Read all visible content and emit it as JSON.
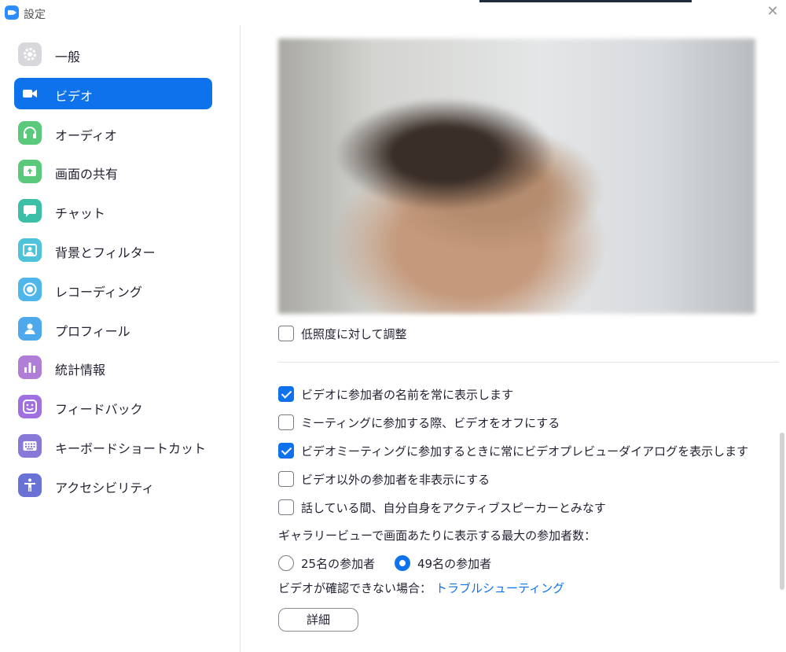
{
  "window": {
    "title": "設定",
    "close_glyph": "✕"
  },
  "sidebar": {
    "items": [
      {
        "label": "一般",
        "icon": "gear-icon",
        "color": "#D8D8DC"
      },
      {
        "label": "ビデオ",
        "icon": "video-icon",
        "color": "#0E72ED",
        "active": true
      },
      {
        "label": "オーディオ",
        "icon": "headphones-icon",
        "color": "#5BC97C"
      },
      {
        "label": "画面の共有",
        "icon": "share-screen-icon",
        "color": "#5BC97C"
      },
      {
        "label": "チャット",
        "icon": "chat-icon",
        "color": "#3BBFA7"
      },
      {
        "label": "背景とフィルター",
        "icon": "background-icon",
        "color": "#4EC3D9"
      },
      {
        "label": "レコーディング",
        "icon": "record-icon",
        "color": "#4EB6E8"
      },
      {
        "label": "プロフィール",
        "icon": "profile-icon",
        "color": "#4EA8EC"
      },
      {
        "label": "統計情報",
        "icon": "statistics-icon",
        "color": "#B07ED6"
      },
      {
        "label": "フィードバック",
        "icon": "feedback-icon",
        "color": "#A070E0"
      },
      {
        "label": "キーボードショートカット",
        "icon": "keyboard-icon",
        "color": "#8878D8"
      },
      {
        "label": "アクセシビリティ",
        "icon": "accessibility-icon",
        "color": "#6A72D6"
      }
    ]
  },
  "video": {
    "low_light_label": "低照度に対して調整",
    "options": [
      {
        "label": "ビデオに参加者の名前を常に表示します",
        "checked": true
      },
      {
        "label": "ミーティングに参加する際、ビデオをオフにする",
        "checked": false
      },
      {
        "label": "ビデオミーティングに参加するときに常にビデオプレビューダイアログを表示します",
        "checked": true
      },
      {
        "label": "ビデオ以外の参加者を非表示にする",
        "checked": false
      },
      {
        "label": "話している間、自分自身をアクティブスピーカーとみなす",
        "checked": false
      }
    ],
    "gallery_label": "ギャラリービューで画面あたりに表示する最大の参加者数：",
    "gallery_options": [
      {
        "label": "25名の参加者",
        "checked": false
      },
      {
        "label": "49名の参加者",
        "checked": true
      }
    ],
    "trouble_label": "ビデオが確認できない場合：",
    "trouble_link": "トラブルシューティング",
    "detail_button": "詳細"
  }
}
